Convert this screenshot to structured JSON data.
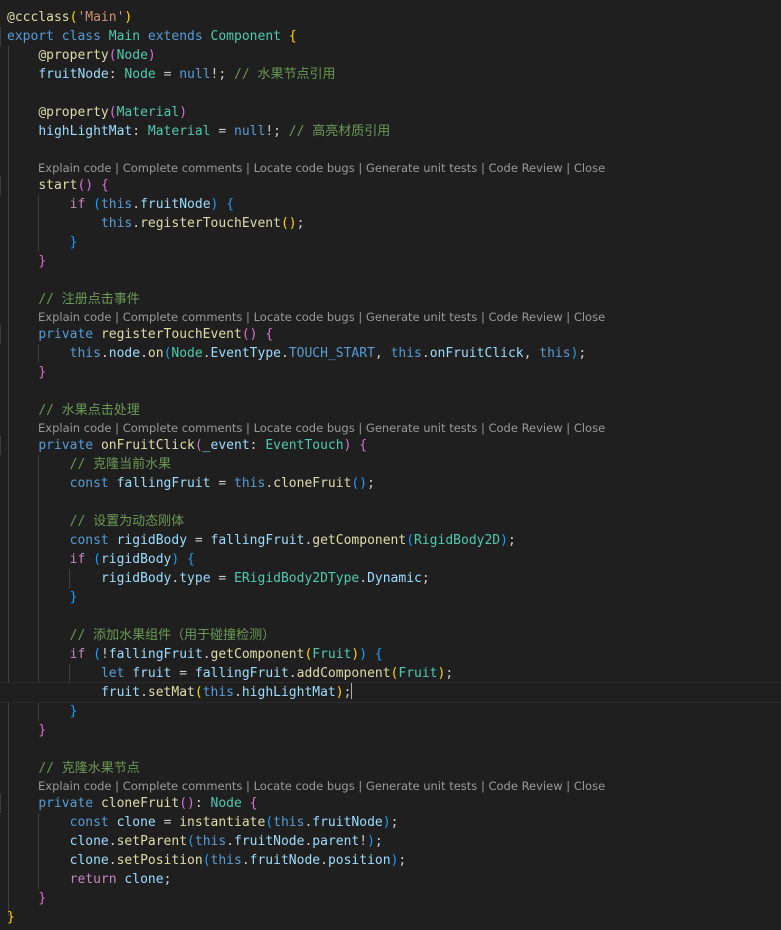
{
  "editor": {
    "language": "typescript",
    "codelens": {
      "actions": [
        "Explain code",
        "Complete comments",
        "Locate code bugs",
        "Generate unit tests",
        "Code Review",
        "Close"
      ]
    },
    "lines": [
      "@ccclass('Main')",
      "export class Main extends Component {",
      "    @property(Node)",
      "    fruitNode: Node = null!; // 水果节点引用",
      "",
      "    @property(Material)",
      "    highLightMat: Material = null!; // 高亮材质引用",
      "",
      "    start() {",
      "        if (this.fruitNode) {",
      "            this.registerTouchEvent();",
      "        }",
      "    }",
      "",
      "    // 注册点击事件",
      "    private registerTouchEvent() {",
      "        this.node.on(Node.EventType.TOUCH_START, this.onFruitClick, this);",
      "    }",
      "",
      "    // 水果点击处理",
      "    private onFruitClick(_event: EventTouch) {",
      "        // 克隆当前水果",
      "        const fallingFruit = this.cloneFruit();",
      "",
      "        // 设置为动态刚体",
      "        const rigidBody = fallingFruit.getComponent(RigidBody2D);",
      "        if (rigidBody) {",
      "            rigidBody.type = ERigidBody2DType.Dynamic;",
      "        }",
      "",
      "        // 添加水果组件（用于碰撞检测）",
      "        if (!fallingFruit.getComponent(Fruit)) {",
      "            let fruit = fallingFruit.addComponent(Fruit);",
      "            fruit.setMat(this.highLightMat);",
      "        }",
      "    }",
      "",
      "    // 克隆水果节点",
      "    private cloneFruit(): Node {",
      "        const clone = instantiate(this.fruitNode);",
      "        clone.setParent(this.fruitNode.parent!);",
      "        clone.setPosition(this.fruitNode.position);",
      "        return clone;",
      "    }",
      "}"
    ]
  }
}
